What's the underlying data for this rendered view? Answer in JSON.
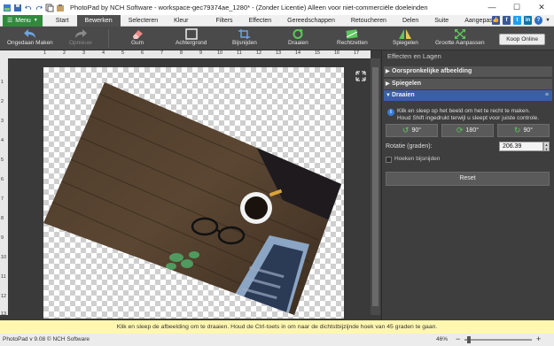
{
  "window": {
    "title": "PhotoPad by NCH Software - workspace-gec79374ae_1280* - (Zonder Licentie) Alleen voor niet-commerciële doeleinden",
    "minimize": "—",
    "maximize": "☐",
    "close": "✕"
  },
  "menubar": {
    "menu_label": "Menu",
    "tabs": [
      "Start",
      "Bewerken",
      "Selecteren",
      "Kleur",
      "Filters",
      "Effecten",
      "Gereedschappen",
      "Retoucheren",
      "Delen",
      "Suite",
      "Aangepast"
    ],
    "active_tab": "Bewerken"
  },
  "toolbar": {
    "undo": "Ongedaan Maken",
    "redo": "Opnieuw",
    "eraser": "Gum",
    "background": "Achtergrond",
    "crop": "Bijsnijden",
    "rotate": "Draaien",
    "straighten": "Rechtzetten",
    "mirror": "Spiegelen",
    "resize": "Grootte Aanpassen",
    "buy": "Koop Online"
  },
  "rulers": {
    "top": [
      "1",
      "2",
      "3",
      "4",
      "5",
      "6",
      "7",
      "8",
      "9",
      "10",
      "11",
      "12",
      "13",
      "14",
      "15",
      "16",
      "17"
    ],
    "left": [
      "1",
      "2",
      "3",
      "4",
      "5",
      "6",
      "7",
      "8",
      "9",
      "10",
      "11",
      "12",
      "13"
    ]
  },
  "panel": {
    "title": "Effecten en Lagen",
    "sections": {
      "original": "Oorspronkelijke afbeelding",
      "mirror": "Spiegelen",
      "rotate": "Draaien"
    },
    "info_line1": "Klik en sleep op het beeld om het te recht te maken.",
    "info_line2": "Houd Shift ingedrukt terwijl u sleept voor juiste controle.",
    "rot_left": "90°",
    "rot_180": "180°",
    "rot_right": "90°",
    "rotation_label": "Rotatie (graden):",
    "rotation_value": "206.39",
    "crop_corners_label": "Hoeken bijsnijden",
    "reset": "Reset"
  },
  "hint": "Klik en sleep de afbeelding om te draaien. Houd de Ctrl-toets in om naar de dichtstbijzijnde hoek van 45 graden te gaan.",
  "status": {
    "version": "PhotoPad v 9.08 © NCH Software",
    "zoom": "46%",
    "zoom_minus": "−",
    "zoom_plus": "+"
  },
  "colors": {
    "menu_green": "#2f8a3e",
    "section_open": "#3a5ea8",
    "hint_bg": "#fff7b0"
  }
}
